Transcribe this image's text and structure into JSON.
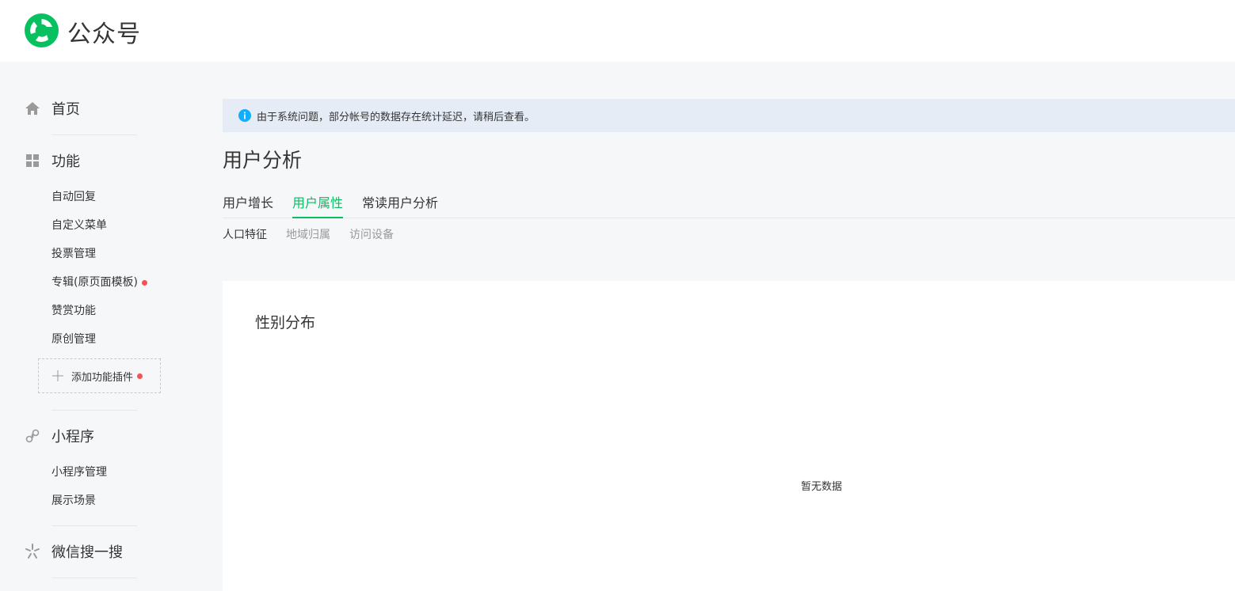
{
  "header": {
    "title": "公众号"
  },
  "sidebar": {
    "home": {
      "label": "首页",
      "icon": "home-icon"
    },
    "features": {
      "label": "功能",
      "icon": "grid-icon",
      "items": [
        "自动回复",
        "自定义菜单",
        "投票管理",
        "专辑(原页面模板)",
        "赞赏功能",
        "原创管理"
      ],
      "add_plugin_label": "添加功能插件"
    },
    "miniprogram": {
      "label": "小程序",
      "icon": "link-icon",
      "items": [
        "小程序管理",
        "展示场景"
      ]
    },
    "search": {
      "label": "微信搜一搜",
      "icon": "search-sparkle-icon"
    }
  },
  "notice": {
    "text": "由于系统问题，部分帐号的数据存在统计延迟，请稍后查看。"
  },
  "main": {
    "title": "用户分析",
    "tabs": [
      "用户增长",
      "用户属性",
      "常读用户分析"
    ],
    "active_tab": "用户属性",
    "subtabs": [
      "人口特征",
      "地域归属",
      "访问设备"
    ],
    "active_subtab": "人口特征",
    "card": {
      "title": "性别分布",
      "empty_text": "暂无数据"
    }
  },
  "colors": {
    "accent": "#07c160",
    "notice_bg": "#e5ecf6",
    "badge": "#fa5151",
    "info": "#10aeff"
  }
}
